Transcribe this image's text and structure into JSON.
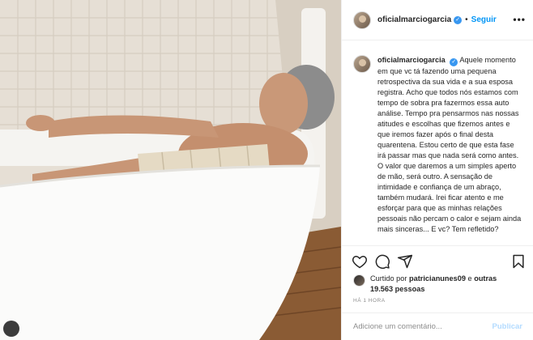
{
  "post": {
    "username": "oficialmarciogarcia",
    "verified_mark": "✓",
    "separator": "•",
    "follow_label": "Seguir",
    "more_icon": "•••",
    "caption": "Aquele momento em que vc tá fazendo uma pequena retrospectiva da sua vida e a sua esposa registra. Acho que todos nós estamos com tempo de sobra pra fazermos essa auto análise. Tempo pra pensarmos nas nossas atitudes e escolhas que fizemos antes e que iremos fazer após o final desta quarentena. Estou certo de que esta fase irá passar mas que nada será como antes. O valor que daremos a um simples aperto de mão, será outro. A sensação de intimidade e confiança de um abraço, também mudará. Irei ficar atento e me esforçar para que as minhas relações pessoais não percam o calor e sejam ainda mais sinceras... E vc? Tem refletido?",
    "likes": {
      "prefix": "Curtido por ",
      "liker": "patricianunes09",
      "middle": " e ",
      "others": "outras 19.563 pessoas"
    },
    "time": "HÁ 1 HORA",
    "comment_placeholder": "Adicione um comentário...",
    "publish_label": "Publicar"
  },
  "icons": [
    "heart-icon",
    "comment-icon",
    "share-icon",
    "bookmark-icon",
    "verified-badge-icon"
  ],
  "colors": {
    "accent": "#0095f6",
    "verified": "#3897f0",
    "muted": "#8e8e8e",
    "publish_disabled": "#b3dbff"
  }
}
